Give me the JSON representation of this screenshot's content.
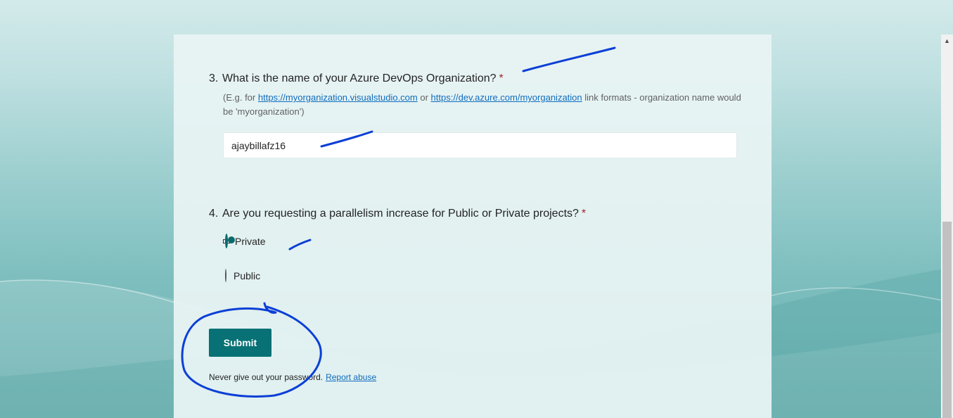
{
  "question3": {
    "number": "3.",
    "title": "What is the name of your Azure DevOps Organization?",
    "required_mark": "*",
    "desc_prefix": "(E.g. for ",
    "link1": "https://myorganization.visualstudio.com",
    "desc_or": " or ",
    "link2": "https://dev.azure.com/myorganization",
    "desc_suffix": " link formats - organization name would be 'myorganization')",
    "answer": "ajaybillafz16"
  },
  "question4": {
    "number": "4.",
    "title": "Are you requesting a parallelism increase for Public or Private projects?",
    "required_mark": "*",
    "options": [
      {
        "label": "Private",
        "selected": true
      },
      {
        "label": "Public",
        "selected": false
      }
    ]
  },
  "submit_label": "Submit",
  "footer": {
    "text": "Never give out your password.",
    "link": "Report abuse"
  },
  "colors": {
    "accent": "#077175",
    "annotation_ink": "#0b3fd6",
    "required": "#a4262c",
    "link": "#0f6cbd"
  },
  "icons": {
    "scroll_up": "chevron-up-icon"
  }
}
